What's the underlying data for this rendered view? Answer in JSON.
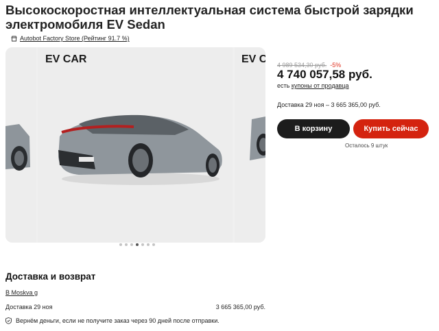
{
  "product": {
    "title": "Высокоскоростная интеллектуальная система быстрой зарядки электромобиля EV Sedan",
    "store_label": "Autobot Factory Store (Рейтинг 91.7 %)",
    "store_icon": "store-icon"
  },
  "gallery": {
    "slide_main_label": "EV CAR",
    "slide_right_label": "EV C",
    "dots_count": 7,
    "active_dot": 4
  },
  "pricing": {
    "old_price": "4 989 534,30 руб.",
    "discount": "-5%",
    "price": "4 740 057,58 руб.",
    "coupon_prefix": "есть",
    "coupon_link": "купоны от продавца",
    "delivery_text": "Доставка 29 ноя – 3 665 365,00 руб."
  },
  "actions": {
    "cart_label": "В корзину",
    "buy_label": "Купить сейчас",
    "stock_text": "Осталось 9 штук"
  },
  "delivery": {
    "section_title": "Доставка и возврат",
    "city": "В Moskva g",
    "row_label": "Доставка 29 ноя",
    "row_value": "3 665 365,00 руб.",
    "guarantee": "Вернём деньги, если не получите заказ через 90 дней после отправки.",
    "guarantee_icon": "shield-icon"
  },
  "colors": {
    "accent": "#d4230f",
    "dark_button": "#1c1c1c",
    "discount": "#e0311f"
  }
}
